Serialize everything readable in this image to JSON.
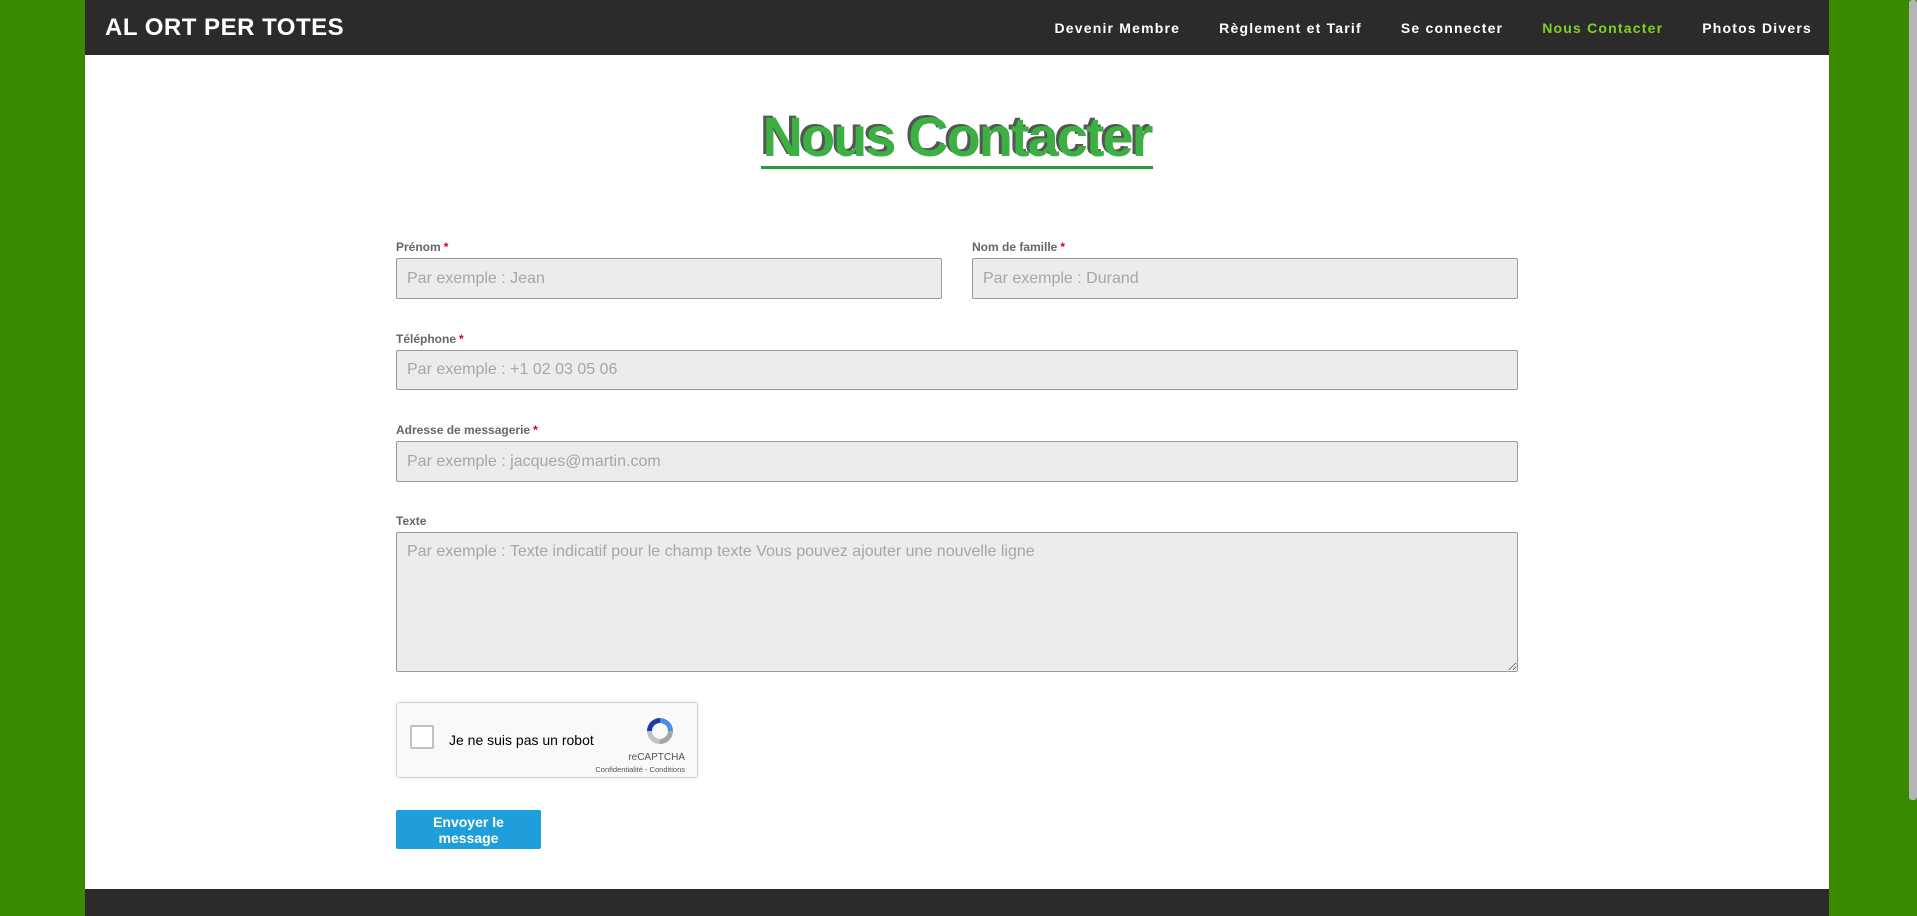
{
  "site": {
    "title": "AL ORT PER TOTES"
  },
  "nav": {
    "items": [
      {
        "label": "Devenir Membre"
      },
      {
        "label": "Règlement et Tarif"
      },
      {
        "label": "Se connecter"
      },
      {
        "label": "Nous Contacter"
      },
      {
        "label": "Photos Divers"
      }
    ],
    "active": "Nous Contacter",
    "active_color": "#7ed321"
  },
  "page": {
    "heading": "Nous Contacter"
  },
  "form": {
    "required_mark": "*",
    "first_name": {
      "label": "Prénom",
      "placeholder": "Par exemple : Jean",
      "value": ""
    },
    "last_name": {
      "label": "Nom de famille",
      "placeholder": "Par exemple : Durand",
      "value": ""
    },
    "phone": {
      "label": "Téléphone",
      "placeholder": "Par exemple : +1 02 03 05 06",
      "value": ""
    },
    "email": {
      "label": "Adresse de messagerie",
      "placeholder": "Par exemple : jacques@martin.com",
      "value": ""
    },
    "text": {
      "label": "Texte",
      "placeholder": "Par exemple : Texte indicatif pour le champ texte Vous pouvez ajouter une nouvelle ligne",
      "value": ""
    },
    "submit_label": "Envoyer le message"
  },
  "captcha": {
    "label": "Je ne suis pas un robot",
    "brand": "reCAPTCHA",
    "links": "Confidentialité - Conditions",
    "checked": false
  },
  "colors": {
    "background": "#3a8a00",
    "header": "#2b2b2b",
    "heading": "#3cb043",
    "button": "#1e9fdb",
    "required": "#d0021b"
  }
}
